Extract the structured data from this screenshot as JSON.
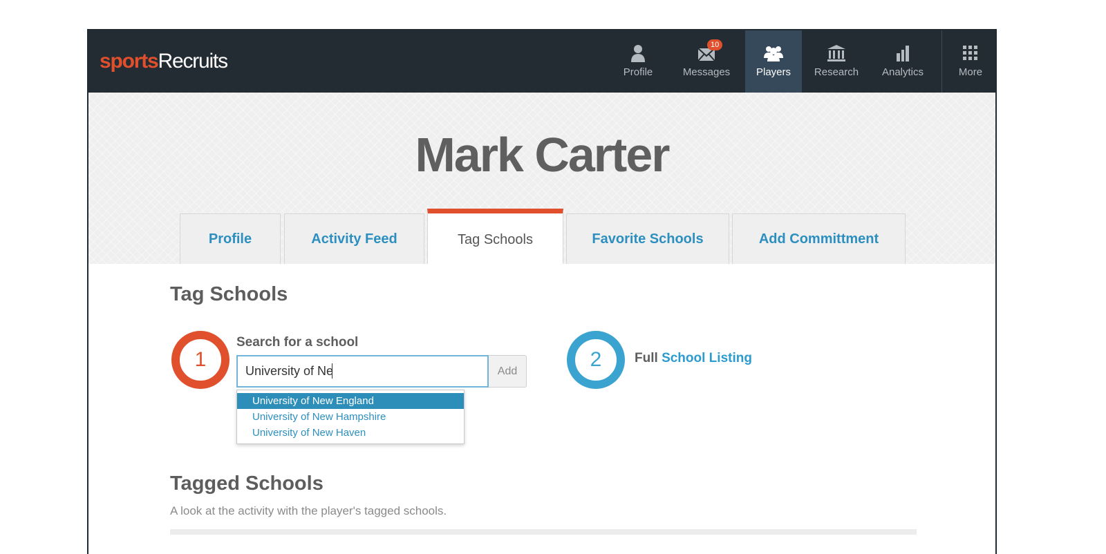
{
  "brand": {
    "sports": "sports",
    "recruits": "Recruits"
  },
  "nav": {
    "items": [
      {
        "label": "Profile",
        "icon": "person-icon"
      },
      {
        "label": "Messages",
        "icon": "envelope-icon",
        "badge": "10"
      },
      {
        "label": "Players",
        "icon": "people-icon",
        "active": true
      },
      {
        "label": "Research",
        "icon": "institution-icon"
      },
      {
        "label": "Analytics",
        "icon": "bar-chart-icon"
      },
      {
        "label": "More",
        "icon": "grid-icon"
      }
    ]
  },
  "player": {
    "name": "Mark Carter"
  },
  "tabs": [
    {
      "label": "Profile"
    },
    {
      "label": "Activity Feed"
    },
    {
      "label": "Tag Schools",
      "active": true
    },
    {
      "label": "Favorite Schools"
    },
    {
      "label": "Add Committment"
    }
  ],
  "tag_schools": {
    "title": "Tag Schools",
    "step1": {
      "number": "1",
      "label": "Search for a school"
    },
    "search": {
      "value": "University of Ne",
      "add_label": "Add"
    },
    "suggestions": [
      "University of New England",
      "University of New Hampshire",
      "University of New Haven"
    ],
    "step2": {
      "number": "2",
      "prefix": "Full",
      "link": "School Listing"
    }
  },
  "tagged": {
    "title": "Tagged Schools",
    "subtitle": "A look at the activity with the player's tagged schools."
  },
  "colors": {
    "nav_bg": "#232b33",
    "nav_active": "#36495a",
    "brand_orange": "#e0502d",
    "link_blue": "#2c8fbf",
    "step2_blue": "#3ba3cf"
  }
}
